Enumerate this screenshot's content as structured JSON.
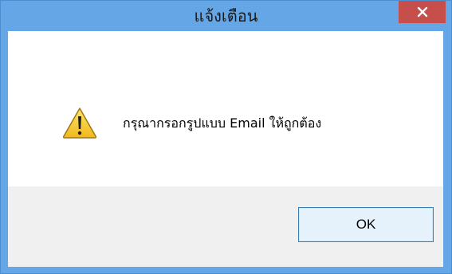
{
  "window": {
    "title": "แจ้งเตือน",
    "close_icon": "close-icon"
  },
  "dialog": {
    "icon": "warning-icon",
    "message": "กรุณากรอกรูปแบบ Email ให้ถูกต้อง",
    "ok_label": "OK"
  },
  "colors": {
    "titlebar": "#65a7e6",
    "close_button": "#c74f4b",
    "footer": "#f0f0f0",
    "button_border": "#3c7fb1",
    "button_fill": "#e5f1fb"
  }
}
